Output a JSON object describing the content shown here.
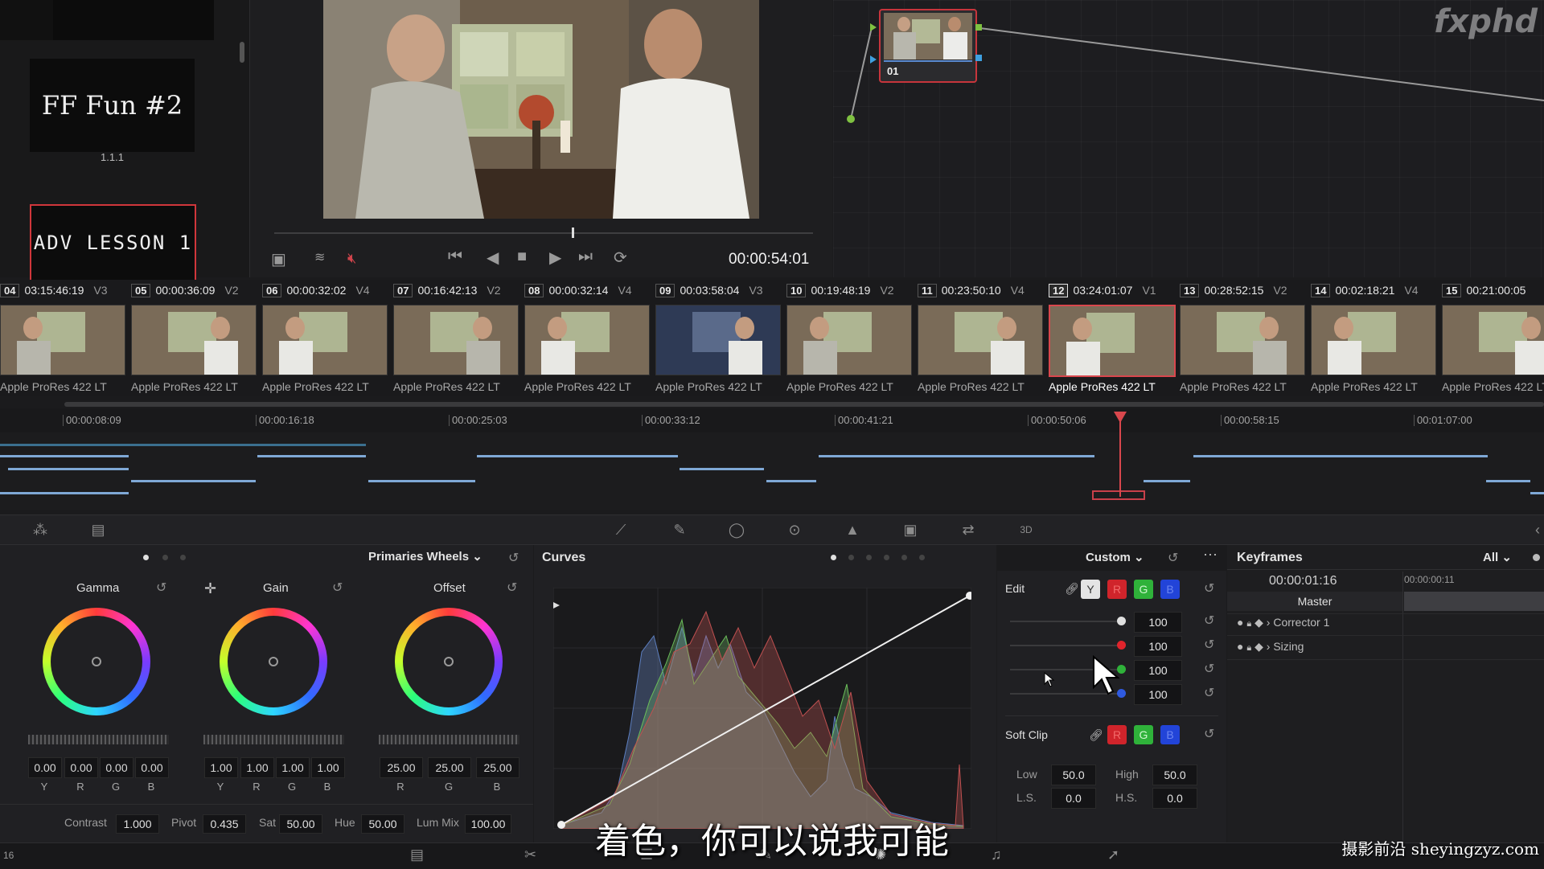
{
  "gallery": {
    "still_title": "FF Fun #2",
    "still_number": "1.1.1",
    "still_adv": "ADV LESSON 1"
  },
  "viewer": {
    "timecode": "00:00:54:01"
  },
  "watermark_logo": "fxphd",
  "node": {
    "label": "01"
  },
  "clips": [
    {
      "num": "04",
      "tc": "03:15:46:19",
      "trk": "V3",
      "codec": "Apple ProRes 422 LT",
      "selected": false
    },
    {
      "num": "05",
      "tc": "00:00:36:09",
      "trk": "V2",
      "codec": "Apple ProRes 422 LT",
      "selected": false
    },
    {
      "num": "06",
      "tc": "00:00:32:02",
      "trk": "V4",
      "codec": "Apple ProRes 422 LT",
      "selected": false
    },
    {
      "num": "07",
      "tc": "00:16:42:13",
      "trk": "V2",
      "codec": "Apple ProRes 422 LT",
      "selected": false
    },
    {
      "num": "08",
      "tc": "00:00:32:14",
      "trk": "V4",
      "codec": "Apple ProRes 422 LT",
      "selected": false
    },
    {
      "num": "09",
      "tc": "00:03:58:04",
      "trk": "V3",
      "codec": "Apple ProRes 422 LT",
      "selected": false
    },
    {
      "num": "10",
      "tc": "00:19:48:19",
      "trk": "V2",
      "codec": "Apple ProRes 422 LT",
      "selected": false
    },
    {
      "num": "11",
      "tc": "00:23:50:10",
      "trk": "V4",
      "codec": "Apple ProRes 422 LT",
      "selected": false
    },
    {
      "num": "12",
      "tc": "03:24:01:07",
      "trk": "V1",
      "codec": "Apple ProRes 422 LT",
      "selected": true
    },
    {
      "num": "13",
      "tc": "00:28:52:15",
      "trk": "V2",
      "codec": "Apple ProRes 422 LT",
      "selected": false
    },
    {
      "num": "14",
      "tc": "00:02:18:21",
      "trk": "V4",
      "codec": "Apple ProRes 422 LT",
      "selected": false
    },
    {
      "num": "15",
      "tc": "00:21:00:05",
      "trk": "",
      "codec": "Apple ProRes 422 LT",
      "selected": false
    }
  ],
  "ruler_ticks": [
    "00:00:08:09",
    "00:00:16:18",
    "00:00:25:03",
    "00:00:33:12",
    "00:00:41:21",
    "00:00:50:06",
    "00:00:58:15",
    "00:01:07:00"
  ],
  "primaries": {
    "mode": "Primaries Wheels",
    "gamma": {
      "label": "Gamma",
      "values": [
        "0.00",
        "0.00",
        "0.00",
        "0.00"
      ],
      "channels": [
        "Y",
        "R",
        "G",
        "B"
      ]
    },
    "gain": {
      "label": "Gain",
      "values": [
        "1.00",
        "1.00",
        "1.00",
        "1.00"
      ],
      "channels": [
        "Y",
        "R",
        "G",
        "B"
      ]
    },
    "offset": {
      "label": "Offset",
      "values": [
        "25.00",
        "25.00",
        "25.00"
      ],
      "channels": [
        "R",
        "G",
        "B"
      ]
    },
    "contrast_label": "Contrast",
    "contrast": "1.000",
    "pivot_label": "Pivot",
    "pivot": "0.435",
    "sat_label": "Sat",
    "sat": "50.00",
    "hue_label": "Hue",
    "hue": "50.00",
    "lummix_label": "Lum Mix",
    "lummix": "100.00"
  },
  "curves": {
    "title": "Curves",
    "preset": "Custom"
  },
  "edit": {
    "label": "Edit",
    "ch_y": "Y",
    "ch_r": "R",
    "ch_g": "G",
    "ch_b": "B",
    "values": [
      "100",
      "100",
      "100",
      "100"
    ],
    "softclip_label": "Soft Clip",
    "low_label": "Low",
    "low": "50.0",
    "high_label": "High",
    "high": "50.0",
    "ls_label": "L.S.",
    "ls": "0.0",
    "hs_label": "H.S.",
    "hs": "0.0"
  },
  "keyframes": {
    "title": "Keyframes",
    "filter": "All",
    "timecode": "00:00:01:16",
    "ruler_tc": "00:00:00:11",
    "master": "Master",
    "rows": [
      "Corrector 1",
      "Sizing"
    ]
  },
  "subtitle": "着色，你可以说我可能",
  "watermark": "摄影前沿 sheyingzyz.com",
  "page_num": "16",
  "colors": {
    "accent_red": "#d9474d",
    "track_blue": "#7fa8d6",
    "panel": "#202023"
  }
}
